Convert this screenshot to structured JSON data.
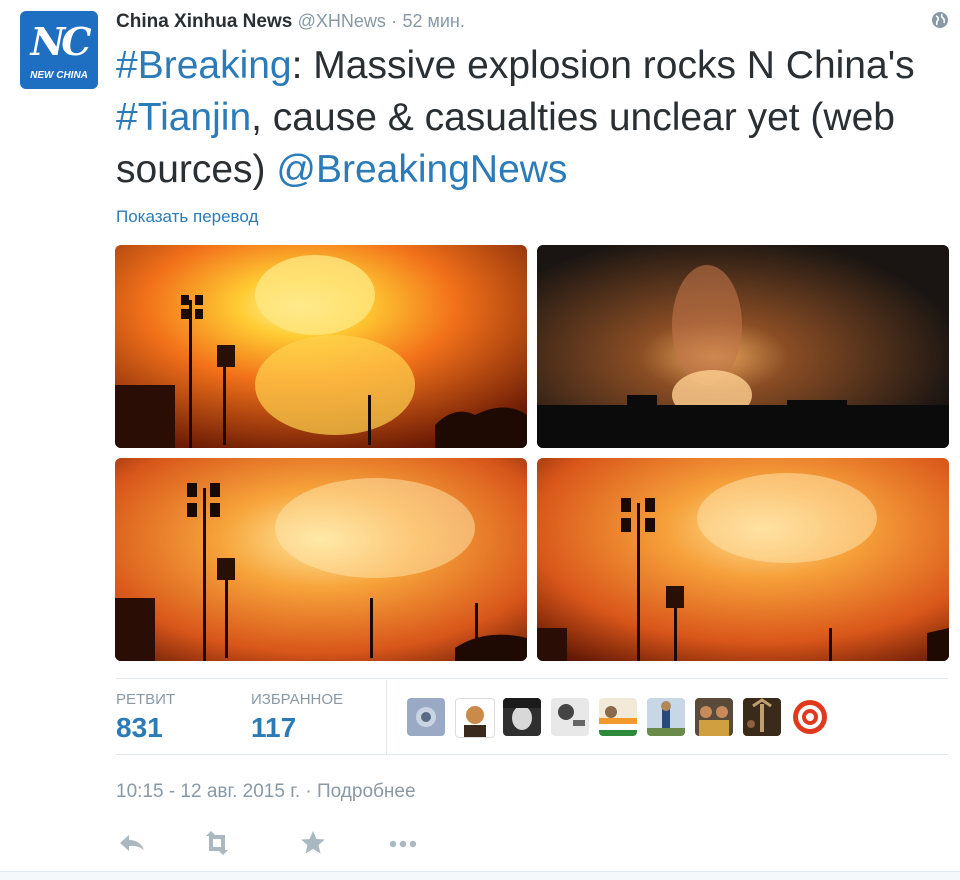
{
  "account": {
    "avatar_text": "NC",
    "avatar_subtext": "NEW CHINA",
    "name": "China Xinhua News",
    "handle": "@XHNews",
    "separator": "·",
    "time_ago": "52 мин."
  },
  "tweet": {
    "hashtag1": "#Breaking",
    "text1": ": Massive explosion rocks N China's ",
    "hashtag2": "#Tianjin",
    "text2": ", cause & casualties unclear yet (web sources) ",
    "mention": "@BreakingNews"
  },
  "translate_link": "Показать перевод",
  "media": [
    {
      "icon": "explosion-photo"
    },
    {
      "icon": "explosion-night-photo"
    },
    {
      "icon": "explosion-photo"
    },
    {
      "icon": "explosion-photo"
    }
  ],
  "stats": {
    "retweets_label": "РЕТВИТ",
    "retweets_value": "831",
    "favorites_label": "ИЗБРАННОЕ",
    "favorites_value": "117"
  },
  "favoriters": [
    {
      "icon": "user-avatar"
    },
    {
      "icon": "user-avatar"
    },
    {
      "icon": "user-avatar"
    },
    {
      "icon": "user-avatar"
    },
    {
      "icon": "user-avatar"
    },
    {
      "icon": "user-avatar"
    },
    {
      "icon": "user-avatar"
    },
    {
      "icon": "user-avatar"
    },
    {
      "icon": "user-avatar"
    }
  ],
  "timestamp": "10:15 - 12 авг. 2015 г.",
  "details_separator": "·",
  "details_link": "Подробнее",
  "actions": [
    "reply-icon",
    "retweet-icon",
    "favorite-icon",
    "more-icon"
  ],
  "colors": {
    "link": "#2b7bb9",
    "muted": "#8899a6",
    "text": "#292f33",
    "brand": "#1e6ec1"
  }
}
